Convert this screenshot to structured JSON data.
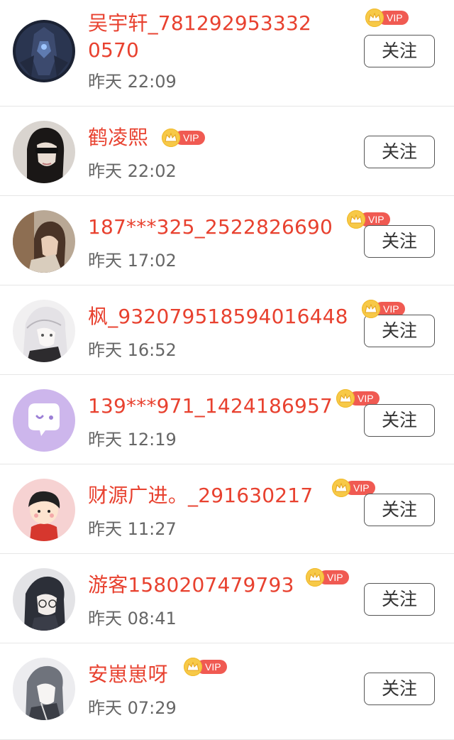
{
  "follow_label": "关注",
  "vip_label": "VIP",
  "users": [
    {
      "name": "吴宇轩_7812929533320570",
      "time": "昨天 22:09",
      "avatar": "dark-mecha-avatar"
    },
    {
      "name": "鹤凌熙",
      "time": "昨天 22:02",
      "avatar": "masked-person-avatar"
    },
    {
      "name": "187***325_2522826690",
      "time": "昨天 17:02",
      "avatar": "girl-photo-avatar"
    },
    {
      "name": "枫_932079518594016448",
      "time": "昨天 16:52",
      "avatar": "anime-white-hair-avatar"
    },
    {
      "name": "139***971_1424186957",
      "time": "昨天 12:19",
      "avatar": "purple-chat-avatar"
    },
    {
      "name": "财源广进。_291630217",
      "time": "昨天 11:27",
      "avatar": "cartoon-boy-avatar"
    },
    {
      "name": "游客1580207479793",
      "time": "昨天 08:41",
      "avatar": "anime-dark-hair-avatar"
    },
    {
      "name": "安崽崽呀",
      "time": "昨天 07:29",
      "avatar": "girl-sketch-avatar"
    }
  ],
  "colors": {
    "name": "#e8412f",
    "time": "#666666",
    "vip_tag": "#f05a52",
    "crown": "#f7c948"
  }
}
